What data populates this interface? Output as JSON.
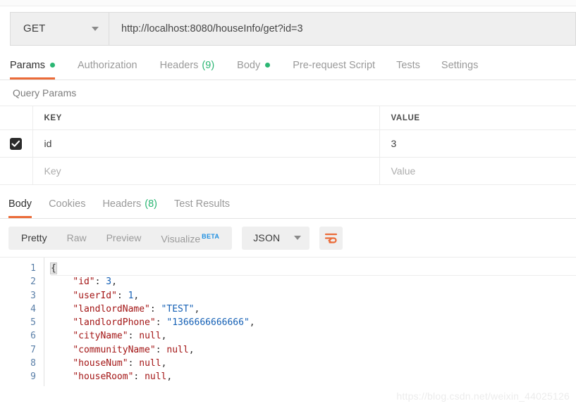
{
  "request": {
    "method": "GET",
    "url": "http://localhost:8080/houseInfo/get?id=3",
    "tabs": [
      {
        "label": "Params",
        "dot": true,
        "active": true
      },
      {
        "label": "Authorization",
        "dot": false,
        "active": false
      },
      {
        "label": "Headers",
        "count": "(9)",
        "active": false
      },
      {
        "label": "Body",
        "dot": true,
        "active": false
      },
      {
        "label": "Pre-request Script",
        "active": false
      },
      {
        "label": "Tests",
        "active": false
      },
      {
        "label": "Settings",
        "active": false
      }
    ]
  },
  "query_params": {
    "section_title": "Query Params",
    "columns": [
      "KEY",
      "VALUE"
    ],
    "rows": [
      {
        "checked": true,
        "key": "id",
        "value": "3",
        "placeholder": false
      },
      {
        "checked": false,
        "key": "Key",
        "value": "Value",
        "placeholder": true
      }
    ]
  },
  "response": {
    "tabs": [
      {
        "label": "Body",
        "active": true
      },
      {
        "label": "Cookies",
        "active": false
      },
      {
        "label": "Headers",
        "count": "(8)",
        "active": false
      },
      {
        "label": "Test Results",
        "active": false
      }
    ],
    "format_tabs": [
      {
        "label": "Pretty",
        "active": true
      },
      {
        "label": "Raw",
        "active": false
      },
      {
        "label": "Preview",
        "active": false
      },
      {
        "label": "Visualize",
        "badge": "BETA",
        "active": false
      }
    ],
    "language": "JSON",
    "wrap_icon": "wrap-text-icon",
    "body_lines": [
      {
        "num": "1",
        "tokens": [
          {
            "t": "{",
            "c": "brace-hl"
          }
        ]
      },
      {
        "num": "2",
        "tokens": [
          {
            "t": "    ",
            "c": "p"
          },
          {
            "t": "\"id\"",
            "c": "k"
          },
          {
            "t": ": ",
            "c": "p"
          },
          {
            "t": "3",
            "c": "n"
          },
          {
            "t": ",",
            "c": "p"
          }
        ]
      },
      {
        "num": "3",
        "tokens": [
          {
            "t": "    ",
            "c": "p"
          },
          {
            "t": "\"userId\"",
            "c": "k"
          },
          {
            "t": ": ",
            "c": "p"
          },
          {
            "t": "1",
            "c": "n"
          },
          {
            "t": ",",
            "c": "p"
          }
        ]
      },
      {
        "num": "4",
        "tokens": [
          {
            "t": "    ",
            "c": "p"
          },
          {
            "t": "\"landlordName\"",
            "c": "k"
          },
          {
            "t": ": ",
            "c": "p"
          },
          {
            "t": "\"TEST\"",
            "c": "s"
          },
          {
            "t": ",",
            "c": "p"
          }
        ]
      },
      {
        "num": "5",
        "tokens": [
          {
            "t": "    ",
            "c": "p"
          },
          {
            "t": "\"landlordPhone\"",
            "c": "k"
          },
          {
            "t": ": ",
            "c": "p"
          },
          {
            "t": "\"1366666666666\"",
            "c": "s"
          },
          {
            "t": ",",
            "c": "p"
          }
        ]
      },
      {
        "num": "6",
        "tokens": [
          {
            "t": "    ",
            "c": "p"
          },
          {
            "t": "\"cityName\"",
            "c": "k"
          },
          {
            "t": ": ",
            "c": "p"
          },
          {
            "t": "null",
            "c": "nul"
          },
          {
            "t": ",",
            "c": "p"
          }
        ]
      },
      {
        "num": "7",
        "tokens": [
          {
            "t": "    ",
            "c": "p"
          },
          {
            "t": "\"communityName\"",
            "c": "k"
          },
          {
            "t": ": ",
            "c": "p"
          },
          {
            "t": "null",
            "c": "nul"
          },
          {
            "t": ",",
            "c": "p"
          }
        ]
      },
      {
        "num": "8",
        "tokens": [
          {
            "t": "    ",
            "c": "p"
          },
          {
            "t": "\"houseNum\"",
            "c": "k"
          },
          {
            "t": ": ",
            "c": "p"
          },
          {
            "t": "null",
            "c": "nul"
          },
          {
            "t": ",",
            "c": "p"
          }
        ]
      },
      {
        "num": "9",
        "tokens": [
          {
            "t": "    ",
            "c": "p"
          },
          {
            "t": "\"houseRoom\"",
            "c": "k"
          },
          {
            "t": ": ",
            "c": "p"
          },
          {
            "t": "null",
            "c": "nul"
          },
          {
            "t": ",",
            "c": "p"
          }
        ]
      }
    ]
  },
  "watermark": "https://blog.csdn.net/weixin_44025126",
  "colors": {
    "accent": "#eb6b38",
    "dot_green": "#2bb673",
    "beta_blue": "#1e8fe1",
    "checkbox": "#2b2b2b"
  }
}
